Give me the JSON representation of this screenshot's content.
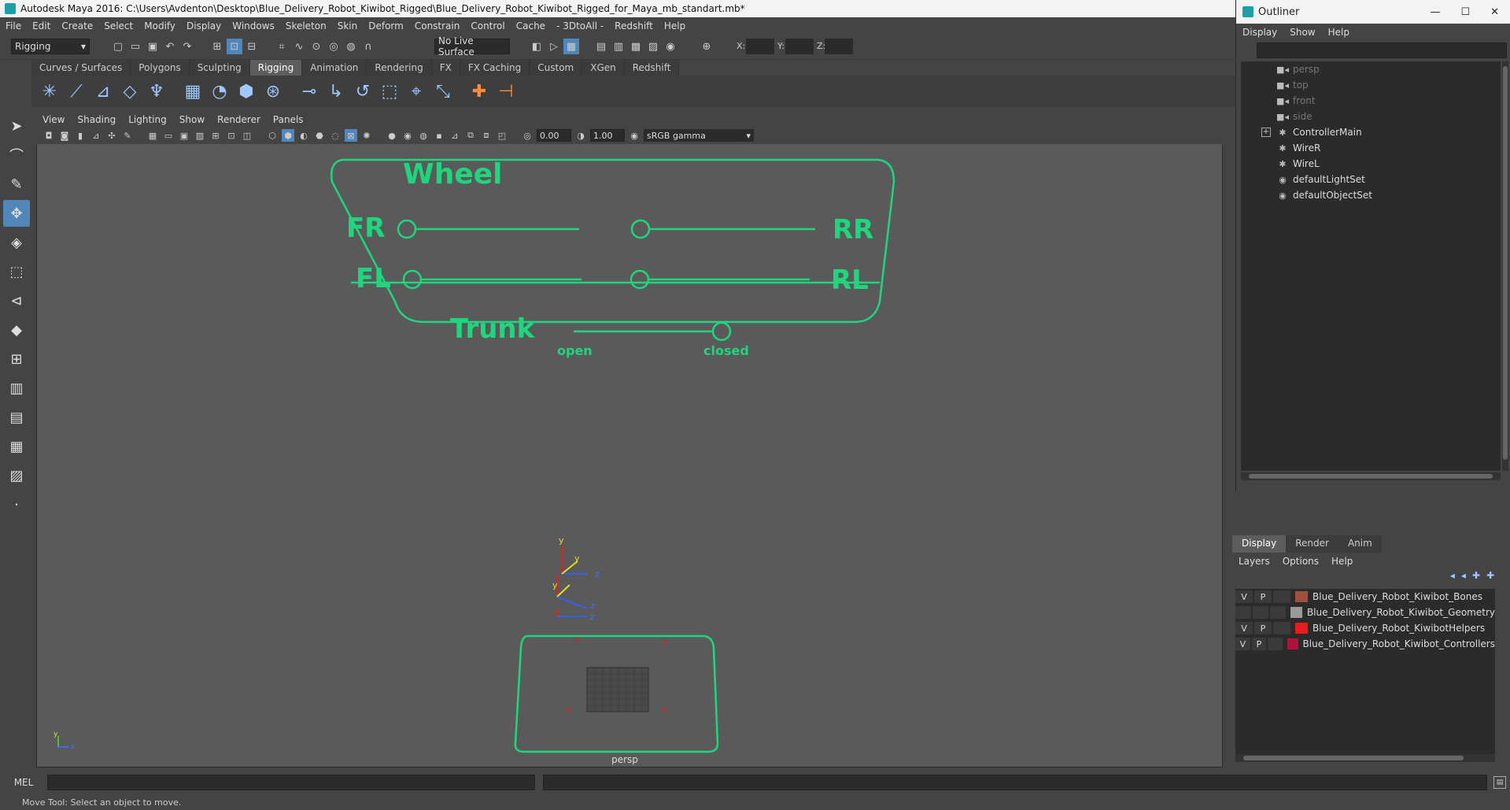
{
  "window": {
    "title": "Autodesk Maya 2016: C:\\Users\\Avdenton\\Desktop\\Blue_Delivery_Robot_Kiwibot_Rigged\\Blue_Delivery_Robot_Kiwibot_Rigged_for_Maya_mb_standart.mb*"
  },
  "menubar": [
    "File",
    "Edit",
    "Create",
    "Select",
    "Modify",
    "Display",
    "Windows",
    "Skeleton",
    "Skin",
    "Deform",
    "Constrain",
    "Control",
    "Cache",
    "- 3DtoAll -",
    "Redshift",
    "Help"
  ],
  "statusline": {
    "mode": "Rigging",
    "live_surface": "No Live Surface",
    "x_label": "X:",
    "y_label": "Y:",
    "z_label": "Z:"
  },
  "shelf_tabs": [
    {
      "label": "Curves / Surfaces",
      "active": false
    },
    {
      "label": "Polygons",
      "active": false
    },
    {
      "label": "Sculpting",
      "active": false
    },
    {
      "label": "Rigging",
      "active": true
    },
    {
      "label": "Animation",
      "active": false
    },
    {
      "label": "Rendering",
      "active": false
    },
    {
      "label": "FX",
      "active": false
    },
    {
      "label": "FX Caching",
      "active": false
    },
    {
      "label": "Custom",
      "active": false
    },
    {
      "label": "XGen",
      "active": false
    },
    {
      "label": "Redshift",
      "active": false
    }
  ],
  "viewport": {
    "menu": [
      "View",
      "Shading",
      "Lighting",
      "Show",
      "Renderer",
      "Panels"
    ],
    "exposure": "0.00",
    "gamma_value": "1.00",
    "color_space": "sRGB gamma",
    "camera_label": "persp",
    "control_board": {
      "title": "Wheel",
      "fr": "FR",
      "rr": "RR",
      "fl": "FL",
      "rl": "RL",
      "trunk": "Trunk",
      "open": "open",
      "closed": "closed"
    },
    "gizmo": {
      "y": "y",
      "z": "z"
    },
    "accent_color": "#1fd67e"
  },
  "outliner": {
    "title": "Outliner",
    "menu": [
      "Display",
      "Show",
      "Help"
    ],
    "items": [
      {
        "label": "persp",
        "icon": "camera-icon",
        "dim": true
      },
      {
        "label": "top",
        "icon": "camera-icon",
        "dim": true
      },
      {
        "label": "front",
        "icon": "camera-icon",
        "dim": true
      },
      {
        "label": "side",
        "icon": "camera-icon",
        "dim": true
      },
      {
        "label": "ControllerMain",
        "icon": "curve-icon",
        "dim": false,
        "expandable": true
      },
      {
        "label": "WireR",
        "icon": "curve-icon",
        "dim": false
      },
      {
        "label": "WireL",
        "icon": "curve-icon",
        "dim": false
      },
      {
        "label": "defaultLightSet",
        "icon": "set-icon",
        "dim": false
      },
      {
        "label": "defaultObjectSet",
        "icon": "set-icon",
        "dim": false
      }
    ]
  },
  "layers": {
    "tabs": [
      {
        "label": "Display",
        "active": true
      },
      {
        "label": "Render",
        "active": false
      },
      {
        "label": "Anim",
        "active": false
      }
    ],
    "menu": [
      "Layers",
      "Options",
      "Help"
    ],
    "rows": [
      {
        "v": "V",
        "p": "P",
        "color": "#a0503c",
        "name": "Blue_Delivery_Robot_Kiwibot_Bones"
      },
      {
        "v": "",
        "p": "",
        "color": "#9a9a9a",
        "name": "Blue_Delivery_Robot_Kiwibot_Geometry"
      },
      {
        "v": "V",
        "p": "P",
        "color": "#e81c1c",
        "name": "Blue_Delivery_Robot_KiwibotHelpers"
      },
      {
        "v": "V",
        "p": "P",
        "color": "#b0143c",
        "name": "Blue_Delivery_Robot_Kiwibot_Controllers"
      }
    ]
  },
  "cmdline": {
    "label": "MEL"
  },
  "helpline": {
    "text": "Move Tool: Select an object to move."
  }
}
